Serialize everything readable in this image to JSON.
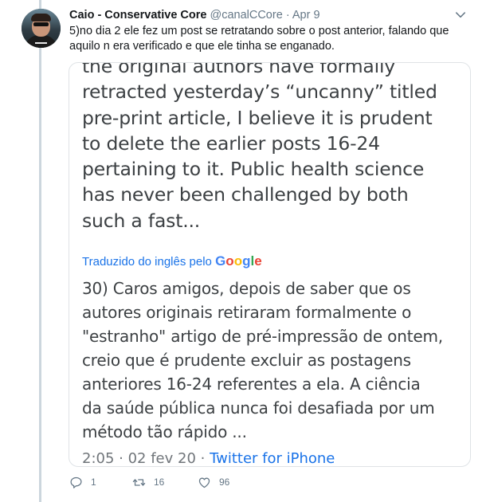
{
  "tweet": {
    "author_name": "Caio - Conservative Core",
    "author_handle": "@canalCCore",
    "separator": "·",
    "date": "Apr 9",
    "text": "5)no dia 2 ele fez um post se retratando sobre o post anterior, falando que aquilo n era verificado e que ele tinha se enganado.",
    "avatar_icon": "avatar-photo",
    "menu_icon": "chevron-down-icon"
  },
  "media": {
    "english_text": "the original authors have formally\nretracted yesterday’s “uncanny” titled\npre-print article, I believe it is prudent\nto delete the earlier posts 16-24\npertaining to it. Public health science\nhas never been challenged by both\nsuch a fast...",
    "translated_label": "Traduzido do inglês pelo",
    "google_letters": [
      "G",
      "o",
      "o",
      "g",
      "l",
      "e"
    ],
    "portuguese_text": "30) Caros amigos, depois de saber que os\nautores originais retiraram formalmente o\n\"estranho\" artigo de pré-impressão de ontem,\ncreio que é prudente excluir as postagens\nanteriores 16-24 referentes a ela. A ciência\nda saúde pública nunca foi desafiada por um\nmétodo tão rápido ...",
    "timestamp": "2:05 · 02 fev 20 ·",
    "source": "Twitter for iPhone"
  },
  "actions": {
    "reply_count": "1",
    "retweet_count": "16",
    "like_count": "96",
    "reply_icon": "reply-icon",
    "retweet_icon": "retweet-icon",
    "like_icon": "heart-icon"
  },
  "colors": {
    "accent": "#1da1f2",
    "muted": "#657786",
    "link": "#1a73e8"
  }
}
